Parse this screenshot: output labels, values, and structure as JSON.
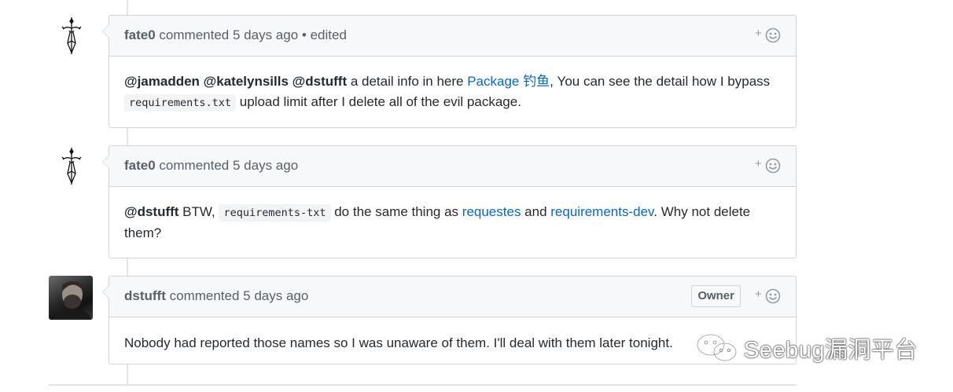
{
  "comments": [
    {
      "author": "fate0",
      "action": "commented",
      "time": "5 days ago",
      "edited": "• edited",
      "avatar_icon": "ornate-sword-icon",
      "body": {
        "m1": "@jamadden",
        "m2": "@katelynsills",
        "m3": "@dstufft",
        "t1": " a detail info in here ",
        "link1": "Package 钓鱼",
        "t2": ", You can see the detail how I bypass ",
        "code1": "requirements.txt",
        "t3": " upload limit after I delete all of the evil package."
      }
    },
    {
      "author": "fate0",
      "action": "commented",
      "time": "5 days ago",
      "avatar_icon": "ornate-sword-icon",
      "body": {
        "m1": "@dstufft",
        "t1": " BTW, ",
        "code1": "requirements-txt",
        "t2": " do the same thing as ",
        "link1": "requestes",
        "t3": " and ",
        "link2": "requirements-dev",
        "t4": ". Why not delete them?"
      }
    },
    {
      "author": "dstufft",
      "action": "commented",
      "time": "5 days ago",
      "badge": "Owner",
      "avatar_icon": "user-photo",
      "body": {
        "t1": "Nobody had reported those names so I was unaware of them. I'll deal with them later tonight."
      }
    }
  ],
  "reaction": {
    "plus": "+",
    "icon": "smiley-icon"
  },
  "watermark": {
    "text": "Seebug漏洞平台",
    "icon": "wechat-icon"
  },
  "colors": {
    "link": "#0366d6",
    "header_bg": "#f6f8fa",
    "border": "#d1d5da",
    "muted": "#586069"
  }
}
